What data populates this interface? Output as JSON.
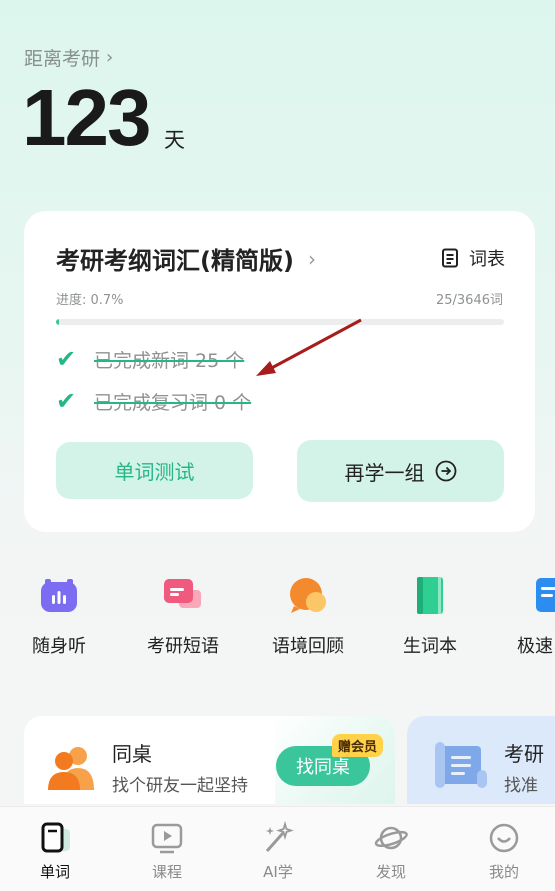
{
  "countdown": {
    "label": "距离考研",
    "days": "123",
    "unit": "天"
  },
  "vocab_card": {
    "book_title": "考研考纲词汇(精简版)",
    "wordlist_label": "词表",
    "progress_label": "进度: 0.7%",
    "progress_count": "25/3646词",
    "progress_fraction": 0.007,
    "tasks": [
      {
        "text": "已完成新词 25 个",
        "done": true
      },
      {
        "text": "已完成复习词 0 个",
        "done": true
      }
    ],
    "test_button": "单词测试",
    "again_button": "再学一组",
    "accent_color": "#3bc59b"
  },
  "shortcuts": [
    {
      "label": "随身听",
      "icon": "headset-icon"
    },
    {
      "label": "考研短语",
      "icon": "chat-bubbles-icon"
    },
    {
      "label": "语境回顾",
      "icon": "chat-bubble-icon"
    },
    {
      "label": "生词本",
      "icon": "notebook-icon"
    },
    {
      "label": "极速",
      "icon": "document-icon"
    }
  ],
  "promos": {
    "deskmate": {
      "title": "同桌",
      "subtitle": "找个研友一起坚持",
      "button": "找同桌",
      "badge": "赠会员"
    },
    "right": {
      "title": "考研",
      "subtitle": "找准"
    }
  },
  "bottom_nav": [
    {
      "label": "单词",
      "icon": "phone-book-icon",
      "active": true
    },
    {
      "label": "课程",
      "icon": "play-screen-icon",
      "active": false
    },
    {
      "label": "AI学",
      "icon": "magic-wand-icon",
      "active": false
    },
    {
      "label": "发现",
      "icon": "planet-icon",
      "active": false
    },
    {
      "label": "我的",
      "icon": "smile-icon",
      "active": false
    }
  ]
}
